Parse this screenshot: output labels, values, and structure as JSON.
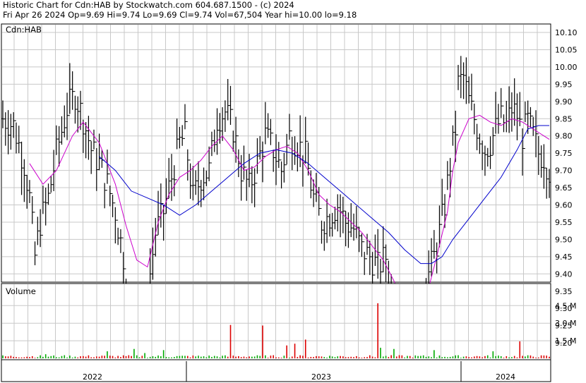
{
  "header": {
    "line1": "Historic Chart for Cdn:HAB by Stockwatch.com 604.687.1500 - (c) 2024",
    "line2": "Fri Apr 26 2024   Op=9.69   Hi=9.74   Lo=9.69   Cl=9.74   Vol=67,504   Year hi=10.00   lo=9.18"
  },
  "colors": {
    "price_bars": "#000000",
    "ma_short": "#cc00cc",
    "ma_long": "#0000cc",
    "volume_up": "#00aa00",
    "volume_down": "#dd0000",
    "grid": "#c8c8c8"
  },
  "chart_data": [
    {
      "type": "ohlc",
      "title": "Cdn:HAB",
      "ylim": [
        9.15,
        10.13
      ],
      "y_ticks": [
        "10.10",
        "10.05",
        "10.00",
        "9.95",
        "9.90",
        "9.85",
        "9.80",
        "9.75",
        "9.70",
        "9.65",
        "9.60",
        "9.55",
        "9.50",
        "9.45",
        "9.40",
        "9.35",
        "9.30",
        "9.25",
        "9.20"
      ],
      "x_labels": [
        "2022",
        "2023",
        "2024"
      ],
      "grid": true,
      "close_path": [
        [
          0,
          9.85
        ],
        [
          4,
          9.83
        ],
        [
          8,
          9.72
        ],
        [
          10,
          9.62
        ],
        [
          12,
          9.45
        ],
        [
          14,
          9.55
        ],
        [
          17,
          9.62
        ],
        [
          20,
          9.75
        ],
        [
          24,
          9.88
        ],
        [
          27,
          9.92
        ],
        [
          30,
          9.85
        ],
        [
          33,
          9.76
        ],
        [
          36,
          9.72
        ],
        [
          39,
          9.66
        ],
        [
          42,
          9.58
        ],
        [
          45,
          9.45
        ],
        [
          47,
          9.28
        ],
        [
          49,
          9.22
        ],
        [
          51,
          9.35
        ],
        [
          53,
          9.22
        ],
        [
          55,
          9.4
        ],
        [
          57,
          9.52
        ],
        [
          60,
          9.58
        ],
        [
          63,
          9.68
        ],
        [
          66,
          9.78
        ],
        [
          68,
          9.8
        ],
        [
          71,
          9.62
        ],
        [
          74,
          9.68
        ],
        [
          77,
          9.7
        ],
        [
          80,
          9.85
        ],
        [
          83,
          9.87
        ],
        [
          86,
          9.82
        ],
        [
          89,
          9.7
        ],
        [
          92,
          9.65
        ],
        [
          95,
          9.72
        ],
        [
          98,
          9.8
        ],
        [
          101,
          9.76
        ],
        [
          104,
          9.7
        ],
        [
          107,
          9.8
        ],
        [
          110,
          9.78
        ],
        [
          113,
          9.74
        ],
        [
          116,
          9.62
        ],
        [
          119,
          9.55
        ],
        [
          122,
          9.57
        ],
        [
          125,
          9.6
        ],
        [
          128,
          9.55
        ],
        [
          131,
          9.53
        ],
        [
          134,
          9.47
        ],
        [
          137,
          9.45
        ],
        [
          140,
          9.42
        ],
        [
          143,
          9.45
        ],
        [
          145,
          9.35
        ],
        [
          147,
          9.25
        ],
        [
          149,
          9.2
        ],
        [
          151,
          9.28
        ],
        [
          153,
          9.25
        ],
        [
          155,
          9.28
        ],
        [
          157,
          9.35
        ],
        [
          159,
          9.4
        ],
        [
          161,
          9.45
        ],
        [
          163,
          9.52
        ],
        [
          165,
          9.6
        ],
        [
          167,
          9.72
        ],
        [
          169,
          9.82
        ],
        [
          170,
          9.95
        ],
        [
          172,
          9.97
        ],
        [
          174,
          9.9
        ],
        [
          176,
          9.85
        ],
        [
          178,
          9.8
        ],
        [
          180,
          9.76
        ],
        [
          182,
          9.78
        ],
        [
          184,
          9.82
        ],
        [
          186,
          9.85
        ],
        [
          188,
          9.83
        ],
        [
          190,
          9.88
        ],
        [
          192,
          9.86
        ],
        [
          194,
          9.8
        ],
        [
          196,
          9.84
        ],
        [
          198,
          9.8
        ],
        [
          200,
          9.75
        ],
        [
          202,
          9.74
        ],
        [
          204,
          9.7
        ]
      ],
      "series": [
        {
          "name": "ma_short",
          "values": [
            [
              10,
              9.72
            ],
            [
              15,
              9.66
            ],
            [
              20,
              9.7
            ],
            [
              26,
              9.8
            ],
            [
              30,
              9.84
            ],
            [
              36,
              9.78
            ],
            [
              42,
              9.66
            ],
            [
              46,
              9.54
            ],
            [
              50,
              9.44
            ],
            [
              54,
              9.42
            ],
            [
              58,
              9.55
            ],
            [
              62,
              9.63
            ],
            [
              66,
              9.68
            ],
            [
              70,
              9.7
            ],
            [
              74,
              9.73
            ],
            [
              78,
              9.77
            ],
            [
              82,
              9.8
            ],
            [
              86,
              9.76
            ],
            [
              90,
              9.7
            ],
            [
              94,
              9.71
            ],
            [
              98,
              9.74
            ],
            [
              102,
              9.76
            ],
            [
              106,
              9.77
            ],
            [
              110,
              9.75
            ],
            [
              114,
              9.7
            ],
            [
              118,
              9.63
            ],
            [
              122,
              9.6
            ],
            [
              126,
              9.58
            ],
            [
              130,
              9.55
            ],
            [
              134,
              9.52
            ],
            [
              138,
              9.48
            ],
            [
              142,
              9.44
            ],
            [
              146,
              9.38
            ],
            [
              150,
              9.31
            ],
            [
              154,
              9.29
            ],
            [
              158,
              9.33
            ],
            [
              162,
              9.45
            ],
            [
              166,
              9.58
            ],
            [
              168,
              9.7
            ],
            [
              170,
              9.78
            ],
            [
              174,
              9.85
            ],
            [
              178,
              9.86
            ],
            [
              182,
              9.84
            ],
            [
              186,
              9.83
            ],
            [
              190,
              9.85
            ],
            [
              194,
              9.84
            ],
            [
              198,
              9.82
            ],
            [
              202,
              9.8
            ],
            [
              204,
              9.79
            ]
          ]
        },
        {
          "name": "ma_long",
          "values": [
            [
              36,
              9.74
            ],
            [
              42,
              9.7
            ],
            [
              48,
              9.64
            ],
            [
              54,
              9.62
            ],
            [
              60,
              9.6
            ],
            [
              66,
              9.57
            ],
            [
              72,
              9.6
            ],
            [
              78,
              9.64
            ],
            [
              84,
              9.68
            ],
            [
              90,
              9.72
            ],
            [
              96,
              9.75
            ],
            [
              102,
              9.76
            ],
            [
              108,
              9.75
            ],
            [
              114,
              9.72
            ],
            [
              120,
              9.68
            ],
            [
              126,
              9.64
            ],
            [
              132,
              9.6
            ],
            [
              138,
              9.56
            ],
            [
              144,
              9.52
            ],
            [
              150,
              9.47
            ],
            [
              156,
              9.43
            ],
            [
              160,
              9.43
            ],
            [
              164,
              9.45
            ],
            [
              168,
              9.5
            ],
            [
              174,
              9.56
            ],
            [
              180,
              9.62
            ],
            [
              186,
              9.68
            ],
            [
              192,
              9.76
            ],
            [
              196,
              9.82
            ],
            [
              200,
              9.83
            ],
            [
              204,
              9.83
            ]
          ]
        }
      ]
    },
    {
      "type": "bar",
      "title": "Volume",
      "y_ticks": [
        "4.5 M",
        "3.0 M",
        "1.5 M"
      ],
      "ylim": [
        0,
        5.2
      ],
      "spikes": [
        [
          16,
          0.35,
          "up"
        ],
        [
          22,
          0.2,
          "up"
        ],
        [
          39,
          0.6,
          "up"
        ],
        [
          49,
          0.8,
          "up"
        ],
        [
          53,
          0.45,
          "up"
        ],
        [
          60,
          0.7,
          "up"
        ],
        [
          85,
          2.85,
          "down"
        ],
        [
          97,
          2.8,
          "down"
        ],
        [
          106,
          1.1,
          "down"
        ],
        [
          109,
          1.25,
          "down"
        ],
        [
          113,
          1.6,
          "down"
        ],
        [
          140,
          4.7,
          "down"
        ],
        [
          141,
          0.9,
          "up"
        ],
        [
          146,
          0.8,
          "up"
        ],
        [
          161,
          0.7,
          "up"
        ],
        [
          183,
          0.6,
          "up"
        ],
        [
          193,
          1.45,
          "down"
        ]
      ]
    }
  ]
}
